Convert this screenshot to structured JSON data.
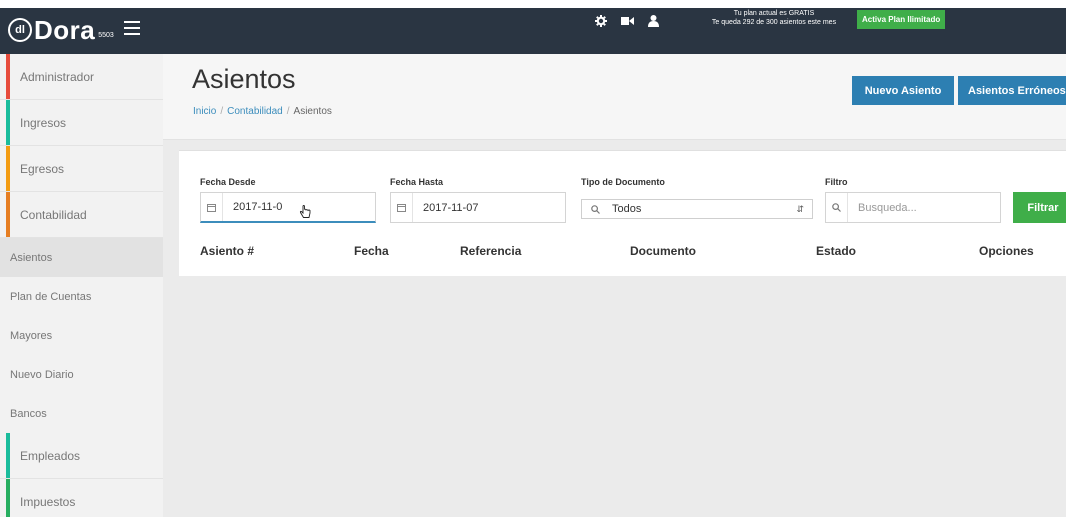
{
  "app": {
    "logo_mark": "dl",
    "logo_name": "Dora",
    "logo_sub": "5503",
    "plan_line1": "Tu plan actual es GRATIS",
    "plan_line2": "Te queda 292 de 300 asientos este mes",
    "plan_button": "Activa Plan Ilimitado"
  },
  "icons": {
    "settings": "gear-icon",
    "video": "video-camera-icon",
    "user": "user-icon",
    "calendar": "calendar-icon",
    "search": "search-icon"
  },
  "colors": {
    "topbar": "#2a3542",
    "primary_button": "#2d7fb2",
    "success": "#3fae49",
    "administrador": "#e74c3c",
    "ingresos": "#1abc9c",
    "egresos": "#f39c12",
    "contabilidad": "#e67e22",
    "empleados": "#1abc9c",
    "impuestos": "#27ae60"
  },
  "sidebar": {
    "items": [
      {
        "label": "Administrador"
      },
      {
        "label": "Ingresos"
      },
      {
        "label": "Egresos"
      },
      {
        "label": "Contabilidad"
      }
    ],
    "sub_items": [
      {
        "label": "Asientos"
      },
      {
        "label": "Plan de Cuentas"
      },
      {
        "label": "Mayores"
      },
      {
        "label": "Nuevo Diario"
      },
      {
        "label": "Bancos"
      }
    ],
    "bottom_items": [
      {
        "label": "Empleados"
      },
      {
        "label": "Impuestos"
      }
    ]
  },
  "page": {
    "title": "Asientos",
    "breadcrumb": [
      "Inicio",
      "Contabilidad",
      "Asientos"
    ],
    "breadcrumb_sep": "/",
    "btn_nuevo": "Nuevo Asiento",
    "btn_erroneos": "Asientos Erróneos"
  },
  "filters": {
    "fecha_desde_label": "Fecha Desde",
    "fecha_desde_value": "2017-11-0",
    "fecha_hasta_label": "Fecha Hasta",
    "fecha_hasta_value": "2017-11-07",
    "tipo_label": "Tipo de Documento",
    "tipo_value": "Todos",
    "filtro_label": "Filtro",
    "filtro_placeholder": "Busqueda...",
    "filtrar_button": "Filtrar"
  },
  "table": {
    "columns": [
      "Asiento #",
      "Fecha",
      "Referencia",
      "Documento",
      "Estado",
      "Opciones"
    ]
  }
}
